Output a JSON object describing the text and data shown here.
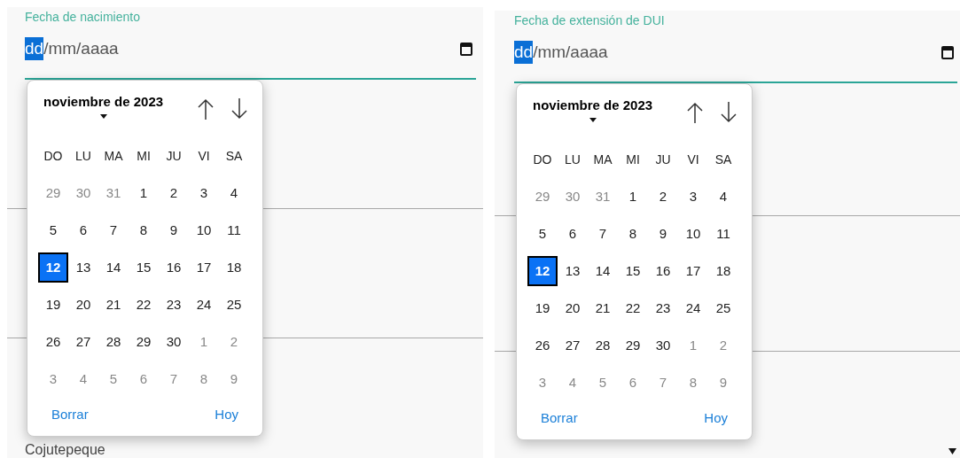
{
  "panels": [
    {
      "field": {
        "label": "Fecha de nacimiento",
        "segments": [
          {
            "text": "dd",
            "selected": true
          },
          {
            "text": "/mm/aaaa",
            "selected": false
          }
        ]
      },
      "calendar": {
        "month": "noviembre de 2023",
        "weekdays": [
          "DO",
          "LU",
          "MA",
          "MI",
          "JU",
          "VI",
          "SA"
        ],
        "weeks": [
          [
            {
              "day": "29",
              "outside": true,
              "selected": false
            },
            {
              "day": "30",
              "outside": true,
              "selected": false
            },
            {
              "day": "31",
              "outside": true,
              "selected": false
            },
            {
              "day": "1",
              "outside": false,
              "selected": false
            },
            {
              "day": "2",
              "outside": false,
              "selected": false
            },
            {
              "day": "3",
              "outside": false,
              "selected": false
            },
            {
              "day": "4",
              "outside": false,
              "selected": false
            }
          ],
          [
            {
              "day": "5",
              "outside": false,
              "selected": false
            },
            {
              "day": "6",
              "outside": false,
              "selected": false
            },
            {
              "day": "7",
              "outside": false,
              "selected": false
            },
            {
              "day": "8",
              "outside": false,
              "selected": false
            },
            {
              "day": "9",
              "outside": false,
              "selected": false
            },
            {
              "day": "10",
              "outside": false,
              "selected": false
            },
            {
              "day": "11",
              "outside": false,
              "selected": false
            }
          ],
          [
            {
              "day": "12",
              "outside": false,
              "selected": true
            },
            {
              "day": "13",
              "outside": false,
              "selected": false
            },
            {
              "day": "14",
              "outside": false,
              "selected": false
            },
            {
              "day": "15",
              "outside": false,
              "selected": false
            },
            {
              "day": "16",
              "outside": false,
              "selected": false
            },
            {
              "day": "17",
              "outside": false,
              "selected": false
            },
            {
              "day": "18",
              "outside": false,
              "selected": false
            }
          ],
          [
            {
              "day": "19",
              "outside": false,
              "selected": false
            },
            {
              "day": "20",
              "outside": false,
              "selected": false
            },
            {
              "day": "21",
              "outside": false,
              "selected": false
            },
            {
              "day": "22",
              "outside": false,
              "selected": false
            },
            {
              "day": "23",
              "outside": false,
              "selected": false
            },
            {
              "day": "24",
              "outside": false,
              "selected": false
            },
            {
              "day": "25",
              "outside": false,
              "selected": false
            }
          ],
          [
            {
              "day": "26",
              "outside": false,
              "selected": false
            },
            {
              "day": "27",
              "outside": false,
              "selected": false
            },
            {
              "day": "28",
              "outside": false,
              "selected": false
            },
            {
              "day": "29",
              "outside": false,
              "selected": false
            },
            {
              "day": "30",
              "outside": false,
              "selected": false
            },
            {
              "day": "1",
              "outside": true,
              "selected": false
            },
            {
              "day": "2",
              "outside": true,
              "selected": false
            }
          ],
          [
            {
              "day": "3",
              "outside": true,
              "selected": false
            },
            {
              "day": "4",
              "outside": true,
              "selected": false
            },
            {
              "day": "5",
              "outside": true,
              "selected": false
            },
            {
              "day": "6",
              "outside": true,
              "selected": false
            },
            {
              "day": "7",
              "outside": true,
              "selected": false
            },
            {
              "day": "8",
              "outside": true,
              "selected": false
            },
            {
              "day": "9",
              "outside": true,
              "selected": false
            }
          ]
        ],
        "clear": "Borrar",
        "today": "Hoy"
      },
      "below": {
        "kind": "text",
        "value": "Cojutepeque"
      }
    },
    {
      "field": {
        "label": "Fecha de extensión de DUI",
        "segments": [
          {
            "text": "dd",
            "selected": true
          },
          {
            "text": "/mm/aaaa",
            "selected": false
          }
        ]
      },
      "calendar": {
        "month": "noviembre de 2023",
        "weekdays": [
          "DO",
          "LU",
          "MA",
          "MI",
          "JU",
          "VI",
          "SA"
        ],
        "weeks": [
          [
            {
              "day": "29",
              "outside": true,
              "selected": false
            },
            {
              "day": "30",
              "outside": true,
              "selected": false
            },
            {
              "day": "31",
              "outside": true,
              "selected": false
            },
            {
              "day": "1",
              "outside": false,
              "selected": false
            },
            {
              "day": "2",
              "outside": false,
              "selected": false
            },
            {
              "day": "3",
              "outside": false,
              "selected": false
            },
            {
              "day": "4",
              "outside": false,
              "selected": false
            }
          ],
          [
            {
              "day": "5",
              "outside": false,
              "selected": false
            },
            {
              "day": "6",
              "outside": false,
              "selected": false
            },
            {
              "day": "7",
              "outside": false,
              "selected": false
            },
            {
              "day": "8",
              "outside": false,
              "selected": false
            },
            {
              "day": "9",
              "outside": false,
              "selected": false
            },
            {
              "day": "10",
              "outside": false,
              "selected": false
            },
            {
              "day": "11",
              "outside": false,
              "selected": false
            }
          ],
          [
            {
              "day": "12",
              "outside": false,
              "selected": true
            },
            {
              "day": "13",
              "outside": false,
              "selected": false
            },
            {
              "day": "14",
              "outside": false,
              "selected": false
            },
            {
              "day": "15",
              "outside": false,
              "selected": false
            },
            {
              "day": "16",
              "outside": false,
              "selected": false
            },
            {
              "day": "17",
              "outside": false,
              "selected": false
            },
            {
              "day": "18",
              "outside": false,
              "selected": false
            }
          ],
          [
            {
              "day": "19",
              "outside": false,
              "selected": false
            },
            {
              "day": "20",
              "outside": false,
              "selected": false
            },
            {
              "day": "21",
              "outside": false,
              "selected": false
            },
            {
              "day": "22",
              "outside": false,
              "selected": false
            },
            {
              "day": "23",
              "outside": false,
              "selected": false
            },
            {
              "day": "24",
              "outside": false,
              "selected": false
            },
            {
              "day": "25",
              "outside": false,
              "selected": false
            }
          ],
          [
            {
              "day": "26",
              "outside": false,
              "selected": false
            },
            {
              "day": "27",
              "outside": false,
              "selected": false
            },
            {
              "day": "28",
              "outside": false,
              "selected": false
            },
            {
              "day": "29",
              "outside": false,
              "selected": false
            },
            {
              "day": "30",
              "outside": false,
              "selected": false
            },
            {
              "day": "1",
              "outside": true,
              "selected": false
            },
            {
              "day": "2",
              "outside": true,
              "selected": false
            }
          ],
          [
            {
              "day": "3",
              "outside": true,
              "selected": false
            },
            {
              "day": "4",
              "outside": true,
              "selected": false
            },
            {
              "day": "5",
              "outside": true,
              "selected": false
            },
            {
              "day": "6",
              "outside": true,
              "selected": false
            },
            {
              "day": "7",
              "outside": true,
              "selected": false
            },
            {
              "day": "8",
              "outside": true,
              "selected": false
            },
            {
              "day": "9",
              "outside": true,
              "selected": false
            }
          ]
        ],
        "clear": "Borrar",
        "today": "Hoy"
      },
      "below": {
        "kind": "dropdown"
      }
    }
  ]
}
